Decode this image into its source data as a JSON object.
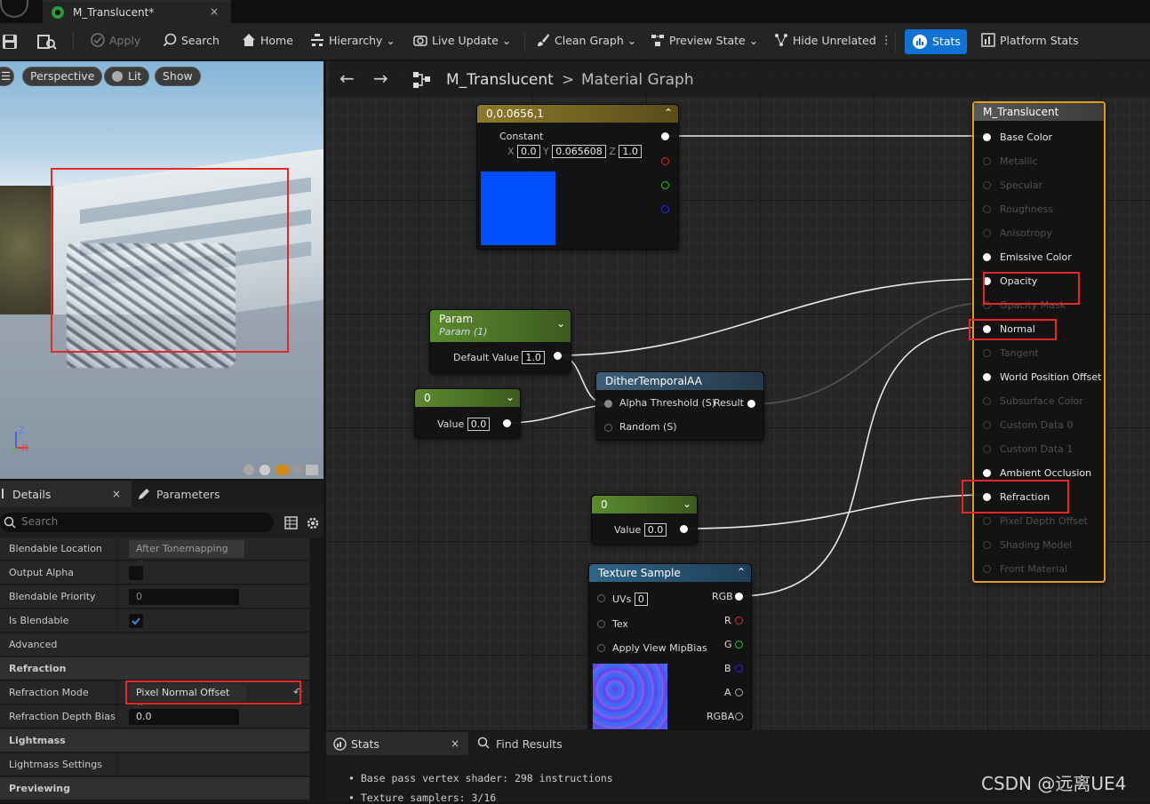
{
  "tab": {
    "title": "M_Translucent*",
    "close": "×"
  },
  "toolbar": {
    "apply": "Apply",
    "search": "Search",
    "home": "Home",
    "hierarchy": "Hierarchy",
    "live_update": "Live Update",
    "clean_graph": "Clean Graph",
    "preview_state": "Preview State",
    "hide_unrelated": "Hide Unrelated",
    "stats": "Stats",
    "platform_stats": "Platform Stats"
  },
  "viewport": {
    "perspective": "Perspective",
    "lit": "Lit",
    "show": "Show",
    "axis_z": "Z",
    "axis_x": "X"
  },
  "details": {
    "tab_details": "Details",
    "tab_params": "Parameters",
    "close": "×",
    "search_placeholder": "Search",
    "rows": [
      {
        "label": "Blendable Location",
        "value": "After Tonemapping"
      },
      {
        "label": "Output Alpha",
        "value": ""
      },
      {
        "label": "Blendable Priority",
        "value": "0"
      },
      {
        "label": "Is Blendable",
        "value": ""
      },
      {
        "label": "Advanced",
        "value": ""
      },
      {
        "label": "Refraction",
        "value": ""
      },
      {
        "label": "Refraction Mode",
        "value": "Pixel Normal Offset"
      },
      {
        "label": "Refraction Depth Bias",
        "value": "0.0"
      },
      {
        "label": "Lightmass",
        "value": ""
      },
      {
        "label": "Lightmass Settings",
        "value": ""
      },
      {
        "label": "Previewing",
        "value": ""
      }
    ]
  },
  "graph": {
    "crumb_material": "M_Translucent",
    "crumb_sep": ">",
    "crumb_graph": "Material Graph",
    "constant3": {
      "title": "0,0.0656,1",
      "label": "Constant",
      "x_label": "X",
      "x": "0.0",
      "y_label": "Y",
      "y": "0.065608",
      "z_label": "Z",
      "z": "1.0",
      "color": "#0050ff"
    },
    "param": {
      "title": "Param",
      "subtitle": "Param (1)",
      "label": "Default Value",
      "value": "1.0"
    },
    "const0_a": {
      "title": "0",
      "label": "Value",
      "value": "0.0"
    },
    "dither": {
      "title": "DitherTemporalAA",
      "in1": "Alpha Threshold (S)",
      "in2": "Random (S)",
      "out": "Result"
    },
    "const0_b": {
      "title": "0",
      "label": "Value",
      "value": "0.0"
    },
    "texture": {
      "title": "Texture Sample",
      "uvs": "UVs",
      "uvs_val": "0",
      "tex": "Tex",
      "mip": "Apply View MipBias",
      "rgb": "RGB",
      "r": "R",
      "g": "G",
      "b": "B",
      "a": "A",
      "rgba": "RGBA"
    },
    "material": {
      "title": "M_Translucent",
      "pins": [
        {
          "label": "Base Color",
          "active": true
        },
        {
          "label": "Metallic",
          "active": false
        },
        {
          "label": "Specular",
          "active": false
        },
        {
          "label": "Roughness",
          "active": false
        },
        {
          "label": "Anisotropy",
          "active": false
        },
        {
          "label": "Emissive Color",
          "active": true
        },
        {
          "label": "Opacity",
          "active": true
        },
        {
          "label": "Opacity Mask",
          "active": false
        },
        {
          "label": "Normal",
          "active": true
        },
        {
          "label": "Tangent",
          "active": false
        },
        {
          "label": "World Position Offset",
          "active": true
        },
        {
          "label": "Subsurface Color",
          "active": false
        },
        {
          "label": "Custom Data 0",
          "active": false
        },
        {
          "label": "Custom Data 1",
          "active": false
        },
        {
          "label": "Ambient Occlusion",
          "active": true
        },
        {
          "label": "Refraction",
          "active": true
        },
        {
          "label": "Pixel Depth Offset",
          "active": false
        },
        {
          "label": "Shading Model",
          "active": false
        },
        {
          "label": "Front Material",
          "active": false
        }
      ]
    }
  },
  "bottom": {
    "stats_tab": "Stats",
    "close": "×",
    "find_tab": "Find Results",
    "lines": [
      "Base pass vertex shader: 298 instructions",
      "Texture samplers: 3/16"
    ]
  },
  "watermark": "CSDN @远离UE4"
}
